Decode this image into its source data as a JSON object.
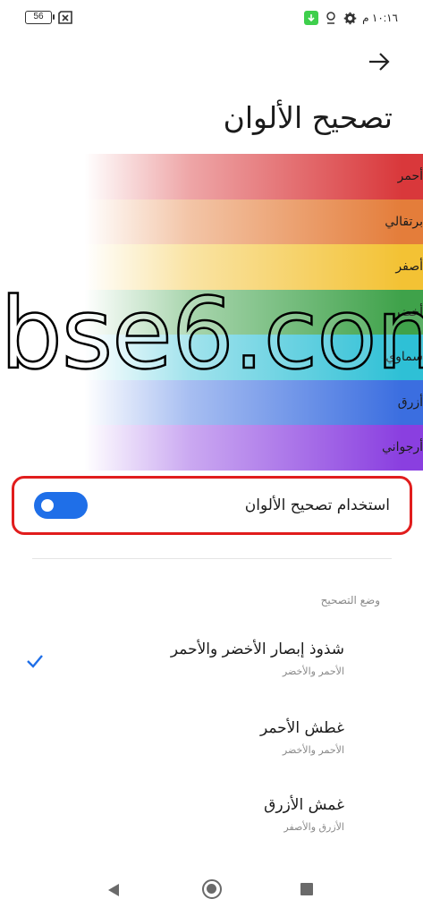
{
  "status_bar": {
    "battery_level": "56",
    "time": "١٠:١٦ م"
  },
  "header": {
    "title": "تصحيح الألوان"
  },
  "preview": {
    "stripes": [
      {
        "label": "أحمر",
        "color": "#d9383b"
      },
      {
        "label": "برتقالي",
        "color": "#e47d3a"
      },
      {
        "label": "أصفر",
        "color": "#f3c234"
      },
      {
        "label": "أخضر",
        "color": "#3fa24a"
      },
      {
        "label": "سماوي",
        "color": "#2ec0d6"
      },
      {
        "label": "أزرق",
        "color": "#3b6ee0"
      },
      {
        "label": "أرجواني",
        "color": "#8a3fe0"
      }
    ]
  },
  "watermark": "bse6.com",
  "toggle": {
    "label": "استخدام تصحيح الألوان",
    "enabled": true,
    "accent": "#1f6fe8"
  },
  "correction_mode": {
    "section_title": "وضع التصحيح",
    "options": [
      {
        "title": "شذوذ إبصار الأخضر والأحمر",
        "subtitle": "الأحمر والأخضر",
        "selected": true
      },
      {
        "title": "غطش الأحمر",
        "subtitle": "الأحمر والأخضر",
        "selected": false
      },
      {
        "title": "غمش الأزرق",
        "subtitle": "الأزرق والأصفر",
        "selected": false
      }
    ]
  },
  "highlight_color": "#e11d1d"
}
